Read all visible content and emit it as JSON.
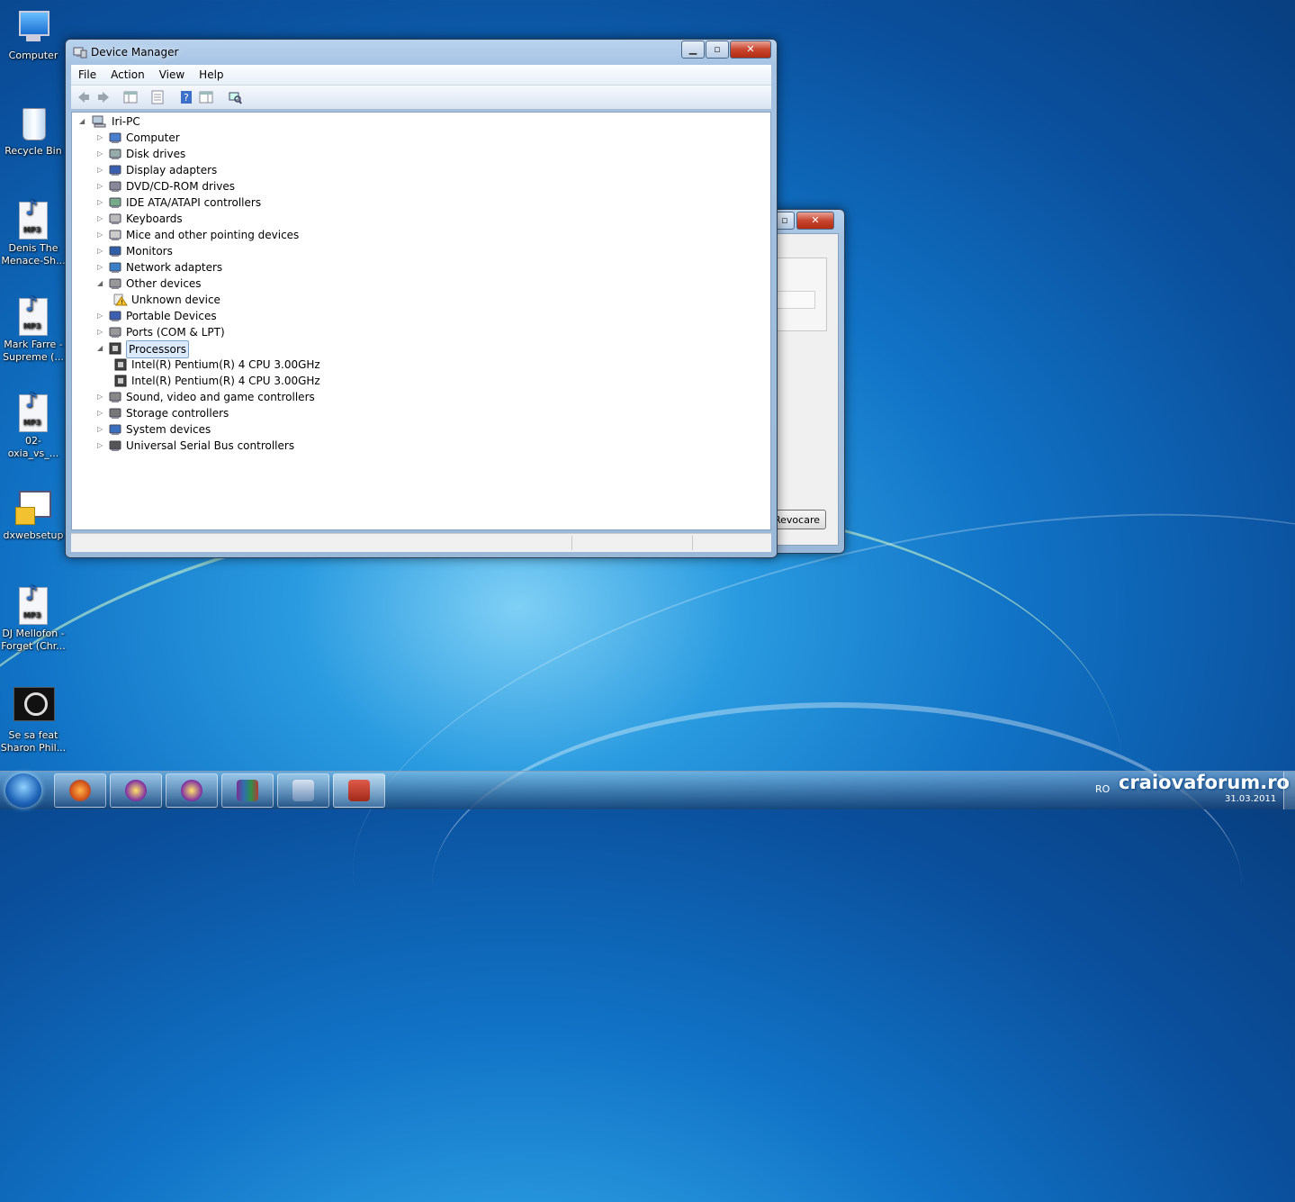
{
  "desktop": {
    "icons": [
      {
        "label": "Computer",
        "type": "computer"
      },
      {
        "label": "Recycle Bin",
        "type": "recycle"
      },
      {
        "label": "Denis The Menace-Sh...",
        "type": "mp3"
      },
      {
        "label": "Mark Farre - Supreme (...",
        "type": "mp3"
      },
      {
        "label": "02-oxia_vs_...",
        "type": "mp3"
      },
      {
        "label": "dxwebsetup",
        "type": "setup"
      },
      {
        "label": "DJ Mellofon - Forget (Chr...",
        "type": "mp3"
      },
      {
        "label": "Se sa feat Sharon Phil...",
        "type": "video"
      }
    ]
  },
  "device_manager": {
    "title": "Device Manager",
    "menu": [
      "File",
      "Action",
      "View",
      "Help"
    ],
    "tree": {
      "root": "Iri-PC",
      "items": [
        {
          "label": "Computer",
          "icon": "computer-icon",
          "expanded": false
        },
        {
          "label": "Disk drives",
          "icon": "disk-icon",
          "expanded": false
        },
        {
          "label": "Display adapters",
          "icon": "display-icon",
          "expanded": false
        },
        {
          "label": "DVD/CD-ROM drives",
          "icon": "dvd-icon",
          "expanded": false
        },
        {
          "label": "IDE ATA/ATAPI controllers",
          "icon": "ide-icon",
          "expanded": false
        },
        {
          "label": "Keyboards",
          "icon": "keyboard-icon",
          "expanded": false
        },
        {
          "label": "Mice and other pointing devices",
          "icon": "mouse-icon",
          "expanded": false
        },
        {
          "label": "Monitors",
          "icon": "monitor-icon",
          "expanded": false
        },
        {
          "label": "Network adapters",
          "icon": "network-icon",
          "expanded": false
        },
        {
          "label": "Other devices",
          "icon": "other-devices-icon",
          "expanded": true
        },
        {
          "label": "Unknown device",
          "icon": "warning-icon",
          "child": true
        },
        {
          "label": "Portable Devices",
          "icon": "portable-icon",
          "expanded": false
        },
        {
          "label": "Ports (COM & LPT)",
          "icon": "port-icon",
          "expanded": false
        },
        {
          "label": "Processors",
          "icon": "processor-icon",
          "expanded": true,
          "selected": true
        },
        {
          "label": "Intel(R) Pentium(R) 4 CPU 3.00GHz",
          "icon": "processor-icon",
          "child": true
        },
        {
          "label": "Intel(R) Pentium(R) 4 CPU 3.00GHz",
          "icon": "processor-icon",
          "child": true
        },
        {
          "label": "Sound, video and game controllers",
          "icon": "sound-icon",
          "expanded": false
        },
        {
          "label": "Storage controllers",
          "icon": "storage-icon",
          "expanded": false
        },
        {
          "label": "System devices",
          "icon": "system-icon",
          "expanded": false
        },
        {
          "label": "Universal Serial Bus controllers",
          "icon": "usb-icon",
          "expanded": false
        }
      ]
    }
  },
  "background_dialog": {
    "button_label": "Revocare"
  },
  "taskbar": {
    "apps": [
      "firefox-icon",
      "yahoo-messenger-icon",
      "yahoo-messenger-icon",
      "winrar-icon",
      "installer-icon",
      "toolbox-icon"
    ],
    "language": "RO",
    "date": "31.03.2011",
    "watermark": "craiovaforum.ro"
  },
  "colors": {
    "selection": "#dbeafc",
    "titlebar": "#b9d3ee",
    "close": "#c8462f"
  }
}
